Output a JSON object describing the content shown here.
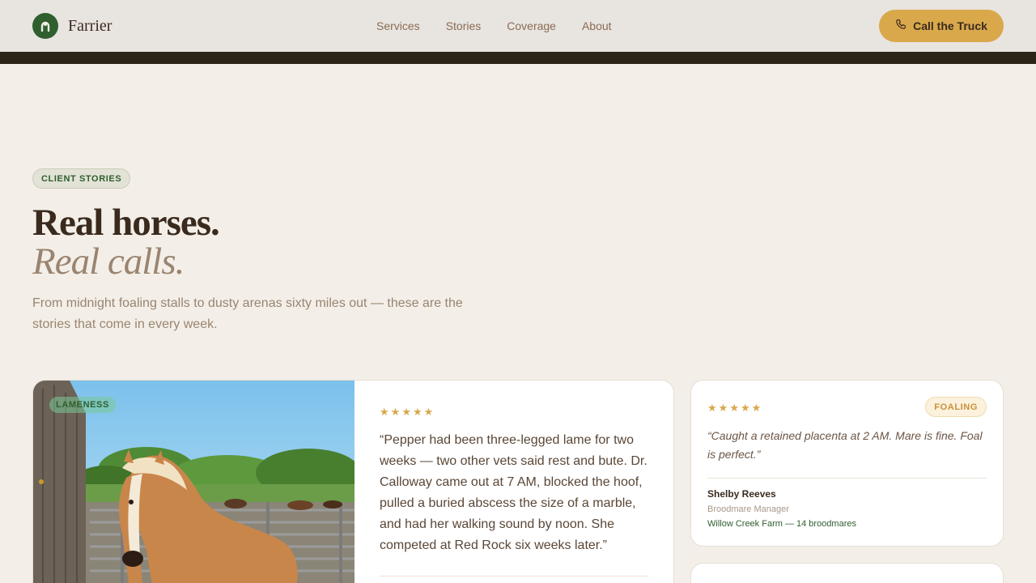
{
  "header": {
    "brand_name": "Farrier",
    "nav": [
      "Services",
      "Stories",
      "Coverage",
      "About"
    ],
    "cta_label": "Call the Truck"
  },
  "hero": {
    "eyebrow": "CLIENT STORIES",
    "title": "Real horses.",
    "title_italic": "Real calls.",
    "lead": "From midnight foaling stalls to dusty arenas sixty miles out — these are the stories that come in every week."
  },
  "featured_story": {
    "tag": "LAMENESS",
    "rating": 5,
    "quote": "“Pepper had been three-legged lame for two weeks — two other vets said rest and bute. Dr. Calloway came out at 7 AM, blocked the hoof, pulled a buried abscess the size of a marble, and had her walking sound by noon. She competed at Red Rock six weeks later.”"
  },
  "side_story": {
    "tag": "FOALING",
    "rating": 5,
    "quote": "“Caught a retained placenta at 2 AM. Mare is fine. Foal is perfect.”",
    "name": "Shelby Reeves",
    "role": "Broodmare Manager",
    "farm": "Willow Creek Farm — 14 broodmares"
  },
  "colors": {
    "brand_green": "#2f5e2f",
    "accent_gold": "#d8a84b",
    "background": "#f3efe8"
  },
  "icons": {
    "logo": "horseshoe-icon",
    "cta": "phone-icon",
    "rating": "star-icon"
  }
}
